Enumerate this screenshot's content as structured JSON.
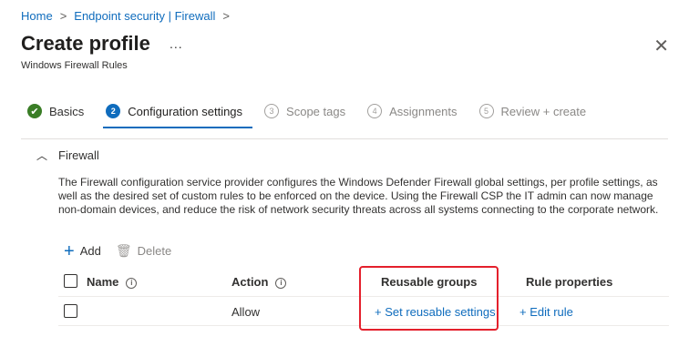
{
  "breadcrumb": {
    "items": [
      "Home",
      "Endpoint security | Firewall"
    ],
    "separator": ">"
  },
  "header": {
    "title": "Create profile",
    "more_label": "...",
    "subtitle": "Windows Firewall Rules",
    "close_label": "✕"
  },
  "wizard": {
    "steps": [
      {
        "number": "✔",
        "label": "Basics",
        "state": "completed"
      },
      {
        "number": "2",
        "label": "Configuration settings",
        "state": "active"
      },
      {
        "number": "3",
        "label": "Scope tags",
        "state": "pending"
      },
      {
        "number": "4",
        "label": "Assignments",
        "state": "pending"
      },
      {
        "number": "5",
        "label": "Review + create",
        "state": "pending"
      }
    ]
  },
  "section": {
    "title": "Firewall",
    "expanded": true,
    "description": "The Firewall configuration service provider configures the Windows Defender Firewall global settings, per profile settings, as well as the desired set of custom rules to be enforced on the device. Using the Firewall CSP the IT admin can now manage non-domain devices, and reduce the risk of network security threats across all systems connecting to the corporate network."
  },
  "toolbar": {
    "add_label": "Add",
    "delete_label": "Delete"
  },
  "table": {
    "columns": [
      "Name",
      "Action",
      "Reusable groups",
      "Rule properties"
    ],
    "rows": [
      {
        "name": "",
        "action": "Allow",
        "reusable_groups": "+ Set reusable settings",
        "rule_properties": "+ Edit rule"
      }
    ]
  },
  "colors": {
    "accent": "#0f6cbd",
    "success": "#3a7d26",
    "highlight": "#e4202c"
  }
}
